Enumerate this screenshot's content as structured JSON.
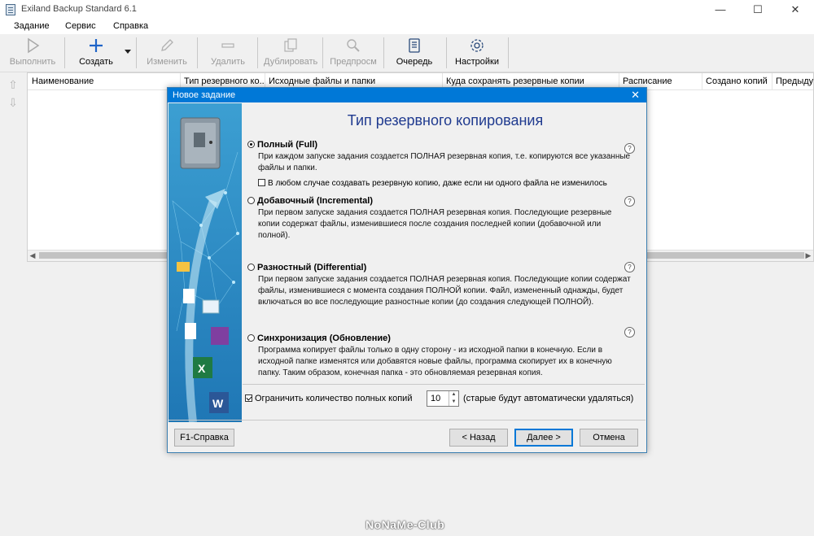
{
  "window": {
    "title": "Exiland Backup Standard 6.1"
  },
  "menu": [
    "Задание",
    "Сервис",
    "Справка"
  ],
  "toolbar": {
    "run": "Выполнить",
    "create": "Создать",
    "edit": "Изменить",
    "delete": "Удалить",
    "duplicate": "Дублировать",
    "preview": "Предпросм",
    "queue": "Очередь",
    "settings": "Настройки"
  },
  "table": {
    "columns": [
      "Наименование",
      "Тип резервного ко...",
      "Исходные файлы и папки",
      "Куда сохранять резервные копии",
      "Расписание",
      "Создано копий",
      "Предыдущ"
    ]
  },
  "dialog": {
    "title": "Новое задание",
    "heading": "Тип резервного копирования",
    "options": [
      {
        "name": "Полный (Full)",
        "desc": "При каждом запуске задания создается ПОЛНАЯ резервная копия, т.е. копируются все указанные файлы и папки.",
        "selected": true
      },
      {
        "name": "Добавочный (Incremental)",
        "desc": "При первом запуске задания создается ПОЛНАЯ резервная копия. Последующие резервные копии содержат файлы, изменившиеся после создания последней копии (добавочной или полной).",
        "selected": false
      },
      {
        "name": "Разностный (Differential)",
        "desc": "При первом запуске задания создается ПОЛНАЯ резервная копия. Последующие копии содержат файлы, изменившиеся с момента создания ПОЛНОЙ копии. Файл, измененный однажды, будет включаться во все последующие разностные копии (до создания следующей ПОЛНОЙ).",
        "selected": false
      },
      {
        "name": "Синхронизация (Обновление)",
        "desc": "Программа копирует файлы только в одну сторону - из исходной папки в конечную. Если в исходной папке изменятся или добавятся новые файлы, программа скопирует их в конечную папку. Таким образом, конечная папка - это обновляемая резервная копия.",
        "selected": false
      }
    ],
    "always_create_label": "В любом случае создавать резервную копию, даже если ни одного файла не изменилось",
    "always_create_checked": false,
    "limit_label": "Ограничить количество полных копий",
    "limit_checked": true,
    "limit_value": "10",
    "limit_note": "(старые будут автоматически удаляться)",
    "help_symbol": "?",
    "buttons": {
      "help": "F1-Справка",
      "back": "< Назад",
      "next": "Далее >",
      "cancel": "Отмена"
    }
  },
  "watermark": "NoNaMe-Club"
}
